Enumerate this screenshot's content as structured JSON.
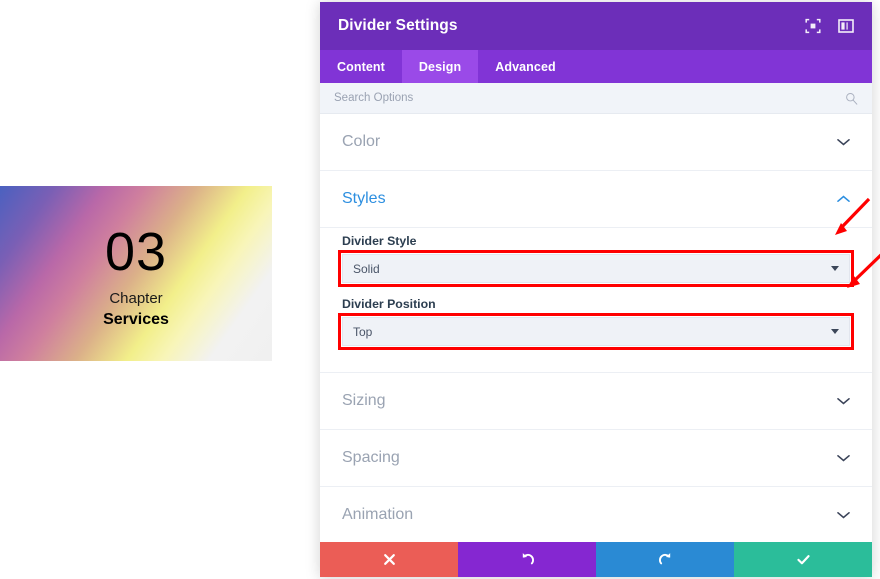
{
  "preview": {
    "chapter_number": "03",
    "chapter_label": "Chapter",
    "chapter_title": "Services",
    "divider_color": "#000000",
    "gradient_colors": [
      "#4a61c0",
      "#b968a8",
      "#f2ef8a",
      "#f0f0f0"
    ]
  },
  "panel": {
    "title": "Divider Settings",
    "header_icons": [
      {
        "name": "focus-target-icon"
      },
      {
        "name": "layout-panel-icon"
      }
    ],
    "accent_purple": "#6c2eb9",
    "tab_bar_color": "#8134d6",
    "active_tab_color": "#9a4ae8",
    "tabs": [
      {
        "label": "Content",
        "active": false
      },
      {
        "label": "Design",
        "active": true
      },
      {
        "label": "Advanced",
        "active": false
      }
    ],
    "search": {
      "placeholder": "Search Options",
      "value": "",
      "icon": "search-icon"
    },
    "sections": [
      {
        "label": "Color",
        "open": false,
        "chevron": "chevron-down-icon"
      },
      {
        "label": "Styles",
        "open": true,
        "chevron": "chevron-up-icon"
      },
      {
        "label": "Sizing",
        "open": false,
        "chevron": "chevron-down-icon"
      },
      {
        "label": "Spacing",
        "open": false,
        "chevron": "chevron-down-icon"
      },
      {
        "label": "Animation",
        "open": false,
        "chevron": "chevron-down-icon"
      }
    ],
    "styles_fields": [
      {
        "label": "Divider Style",
        "value": "Solid",
        "highlighted": true
      },
      {
        "label": "Divider Position",
        "value": "Top",
        "highlighted": true
      }
    ],
    "footer_buttons": [
      {
        "name": "cancel-button",
        "icon": "close-x-icon",
        "color": "#eb5d56"
      },
      {
        "name": "undo-button",
        "icon": "undo-arrow-icon",
        "color": "#8527d1"
      },
      {
        "name": "redo-button",
        "icon": "redo-arrow-icon",
        "color": "#2a8ad4"
      },
      {
        "name": "save-button",
        "icon": "check-icon",
        "color": "#2bbd9a"
      }
    ]
  },
  "annotations": {
    "arrow_color": "#ff0000",
    "highlight_color": "#ff0000",
    "arrows": [
      {
        "name": "arrow-to-divider-style"
      },
      {
        "name": "arrow-to-divider-position"
      }
    ]
  }
}
